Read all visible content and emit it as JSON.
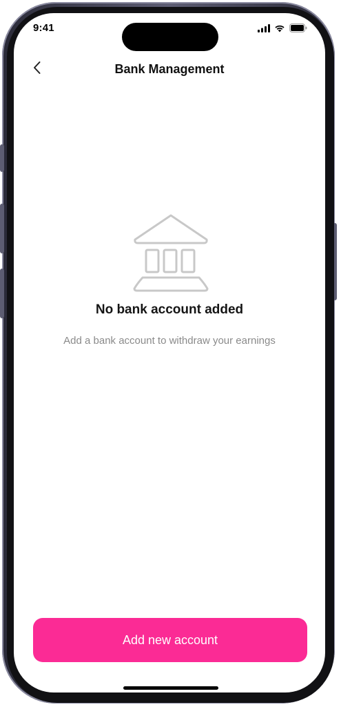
{
  "status_bar": {
    "time": "9:41",
    "icons": [
      "signal-icon",
      "wifi-icon",
      "battery-icon"
    ]
  },
  "header": {
    "back_icon": "chevron-left-icon",
    "title": "Bank Management"
  },
  "empty_state": {
    "icon": "bank-icon",
    "title": "No bank account added",
    "subtitle": "Add a bank account to withdraw your earnings"
  },
  "footer": {
    "add_account_label": "Add new account"
  },
  "colors": {
    "accent": "#fb2b95",
    "icon_gray": "#c8c8c8",
    "subtitle_gray": "#8a8a8a"
  }
}
